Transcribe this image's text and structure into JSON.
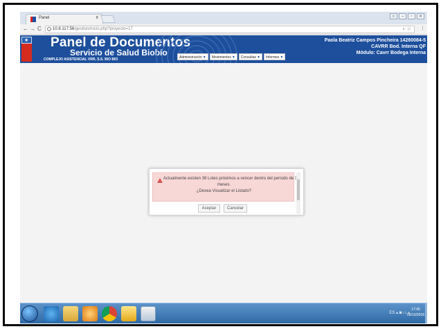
{
  "browser": {
    "tab_title": "Panel",
    "tab_close": "x",
    "url_host": "10.8.117.56",
    "url_path": "/gestion/inicio.php?proyecto=17",
    "back": "←",
    "forward": "→",
    "reload": "C",
    "menu_dots": "⋮",
    "omni_right": "♀ ☆"
  },
  "header": {
    "title": "Panel de Documentos",
    "subtitle": "Servicio de Salud Biobío",
    "complex": "COMPLEJO ASISTENCIAL VRR, S.S. BIO BIO",
    "user_name": "Paola Beatriz Campos Pincheira 14280084-5",
    "user_role": "CAVRR Bod. Interna QF",
    "user_module": "Módulo: Cavrr Bodega Interna"
  },
  "menu": [
    {
      "label": "Administración"
    },
    {
      "label": "Movimientos"
    },
    {
      "label": "Consultas"
    },
    {
      "label": "Informes"
    }
  ],
  "dialog": {
    "line1": "Actualmente existen 39 Lotes próximos a vencer dentro del período de 3",
    "line2": "meses.",
    "line3": "¿Desea Visualizar el Listado?",
    "ok_label": "Aceptar",
    "cancel_label": "Cancelar"
  },
  "taskbar": {
    "tray_text": "ES ▴ ◙ ▭ ◐",
    "time": "17:45",
    "date": "06/10/2018"
  }
}
